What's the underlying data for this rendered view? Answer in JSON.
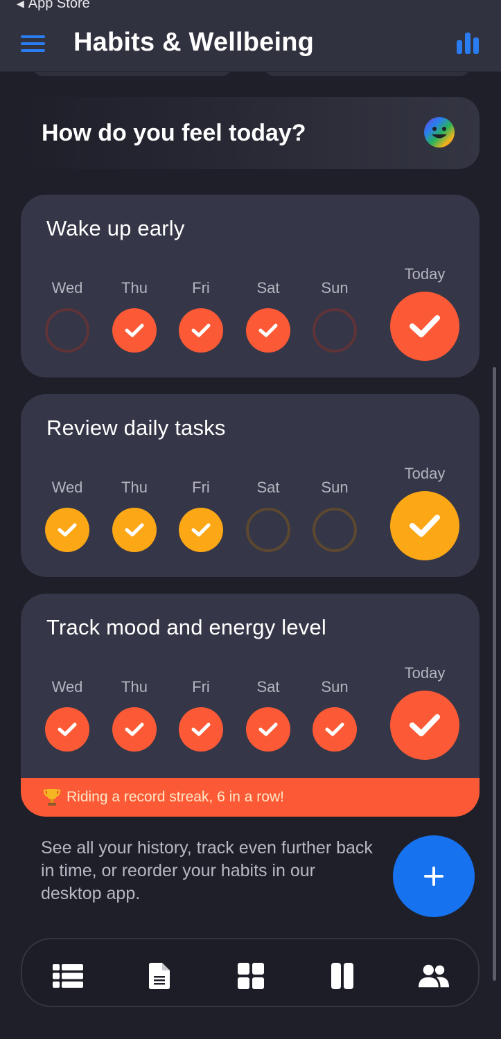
{
  "status_bar": {
    "back_label": "App Store"
  },
  "header": {
    "title": "Habits & Wellbeing"
  },
  "mood": {
    "prompt": "How do you feel today?"
  },
  "habits": [
    {
      "title": "Wake up early",
      "color": "#fc5a36",
      "days": [
        {
          "label": "Wed",
          "done": false
        },
        {
          "label": "Thu",
          "done": true
        },
        {
          "label": "Fri",
          "done": true
        },
        {
          "label": "Sat",
          "done": true
        },
        {
          "label": "Sun",
          "done": false
        }
      ],
      "today": {
        "label": "Today",
        "done": true
      }
    },
    {
      "title": "Review daily tasks",
      "color": "#fca816",
      "days": [
        {
          "label": "Wed",
          "done": true
        },
        {
          "label": "Thu",
          "done": true
        },
        {
          "label": "Fri",
          "done": true
        },
        {
          "label": "Sat",
          "done": false
        },
        {
          "label": "Sun",
          "done": false
        }
      ],
      "today": {
        "label": "Today",
        "done": true
      }
    },
    {
      "title": "Track mood and energy level",
      "color": "#fc5a36",
      "days": [
        {
          "label": "Wed",
          "done": true
        },
        {
          "label": "Thu",
          "done": true
        },
        {
          "label": "Fri",
          "done": true
        },
        {
          "label": "Sat",
          "done": true
        },
        {
          "label": "Sun",
          "done": true
        }
      ],
      "today": {
        "label": "Today",
        "done": true
      },
      "banner": "Riding a record streak, 6 in a row!"
    }
  ],
  "footer": {
    "text": "See all your history, track even further back in time, or reorder your habits in our desktop app."
  },
  "nav": [
    "list-icon",
    "document-icon",
    "grid-icon",
    "columns-icon",
    "people-icon"
  ],
  "colors": {
    "accent_blue": "#1672ee",
    "red": "#fc5a36",
    "yellow": "#fca816",
    "background": "#1e1f29",
    "card": "#353647"
  }
}
